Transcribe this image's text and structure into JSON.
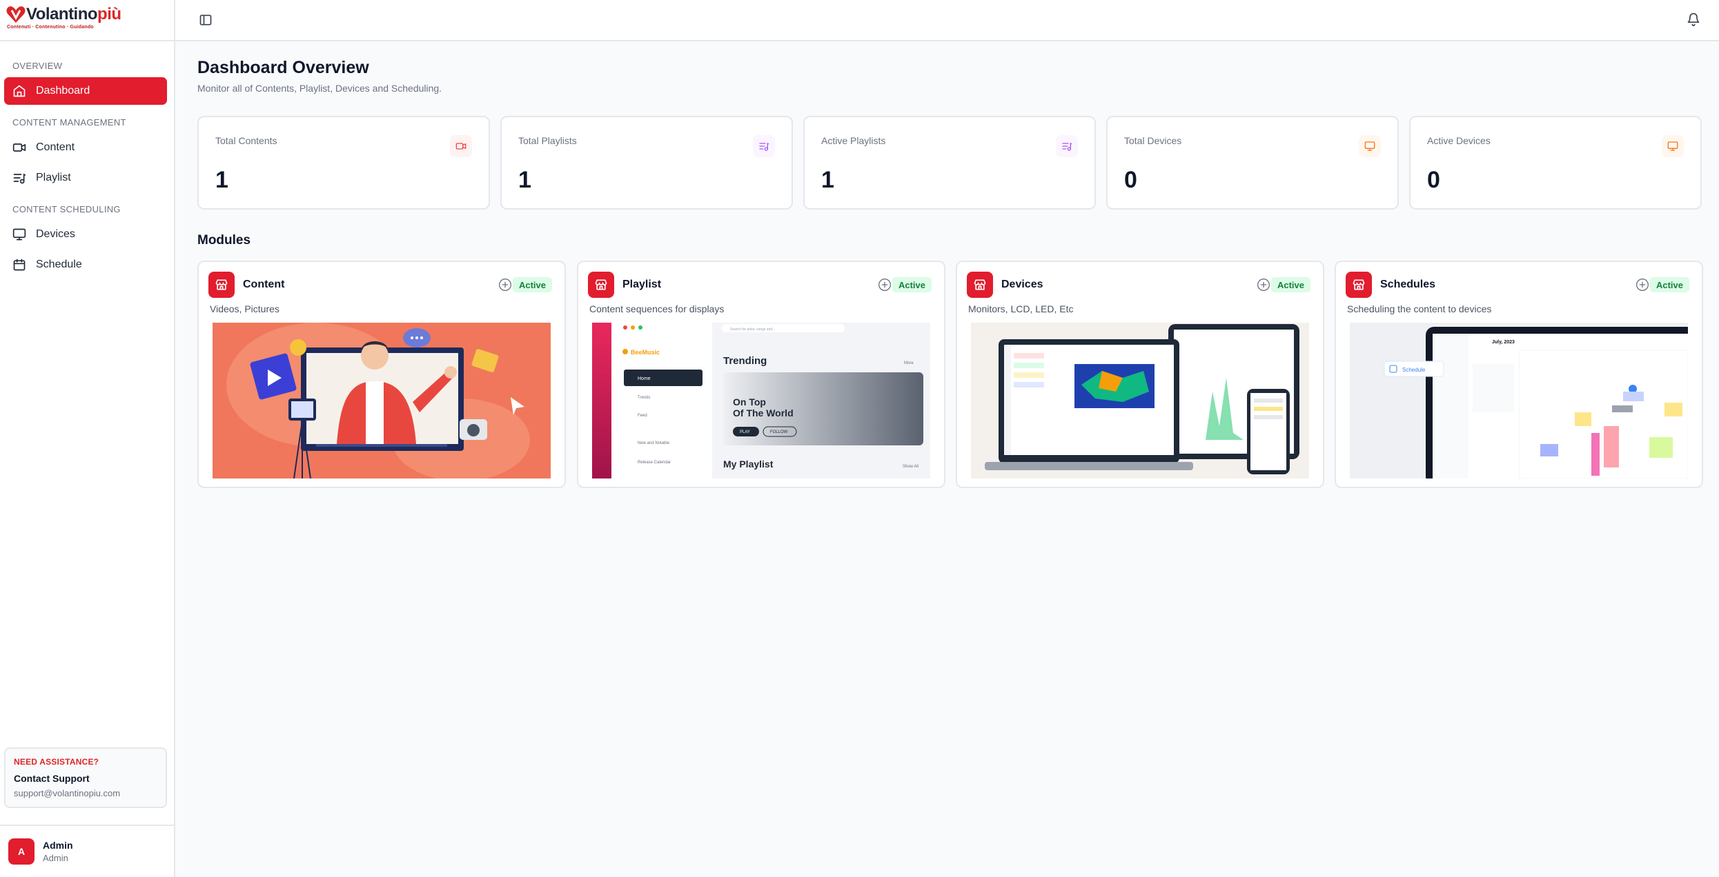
{
  "brand": {
    "name_part1": "Volantino",
    "name_part2": "più",
    "tagline": "Contenuti · Contenutino · Guidando"
  },
  "sidebar": {
    "sections": [
      {
        "title": "OVERVIEW"
      },
      {
        "title": "CONTENT MANAGEMENT"
      },
      {
        "title": "CONTENT SCHEDULING"
      }
    ],
    "items": [
      {
        "label": "Dashboard",
        "icon": "home-icon",
        "active": true
      },
      {
        "label": "Content",
        "icon": "video-icon"
      },
      {
        "label": "Playlist",
        "icon": "playlist-icon"
      },
      {
        "label": "Devices",
        "icon": "monitor-icon"
      },
      {
        "label": "Schedule",
        "icon": "calendar-icon"
      }
    ],
    "support": {
      "title": "NEED ASSISTANCE?",
      "name": "Contact Support",
      "email": "support@volantinopiu.com"
    },
    "user": {
      "initial": "A",
      "name": "Admin",
      "role": "Admin"
    }
  },
  "topbar": {
    "toggle_icon": "sidebar-toggle-icon",
    "bell_icon": "bell-icon"
  },
  "main": {
    "title": "Dashboard Overview",
    "subtitle": "Monitor all of Contents, Playlist, Devices and Scheduling.",
    "stats": [
      {
        "label": "Total Contents",
        "value": "1",
        "icon": "video-icon",
        "color": "#ef4444",
        "bg": "#fef2f2"
      },
      {
        "label": "Total Playlists",
        "value": "1",
        "icon": "playlist-icon",
        "color": "#a855f7",
        "bg": "#faf5ff"
      },
      {
        "label": "Active Playlists",
        "value": "1",
        "icon": "playlist-icon",
        "color": "#a855f7",
        "bg": "#faf5ff"
      },
      {
        "label": "Total Devices",
        "value": "0",
        "icon": "monitor-icon",
        "color": "#f97316",
        "bg": "#fff7ed"
      },
      {
        "label": "Active Devices",
        "value": "0",
        "icon": "monitor-icon",
        "color": "#f97316",
        "bg": "#fff7ed"
      }
    ],
    "modules_title": "Modules",
    "modules": [
      {
        "name": "Content",
        "description": "Videos, Pictures",
        "status": "Active"
      },
      {
        "name": "Playlist",
        "description": "Content sequences for displays",
        "status": "Active"
      },
      {
        "name": "Devices",
        "description": "Monitors, LCD, LED, Etc",
        "status": "Active"
      },
      {
        "name": "Schedules",
        "description": "Scheduling the content to devices",
        "status": "Active"
      }
    ],
    "playlist_preview": {
      "app": "BeeMusic",
      "nav": [
        "Home",
        "Trends",
        "Feed",
        "New and Notable",
        "Release Calendar"
      ],
      "search": "Search for artist, songs and...",
      "section": "Trending",
      "more": "More",
      "hero_title_1": "On Top",
      "hero_title_2": "Of The World",
      "play": "PLAY",
      "follow": "FOLLOW",
      "my_playlist": "My Playlist",
      "show_all": "Show All"
    },
    "schedule_preview": {
      "tag": "Schedule",
      "month": "July, 2023"
    }
  }
}
